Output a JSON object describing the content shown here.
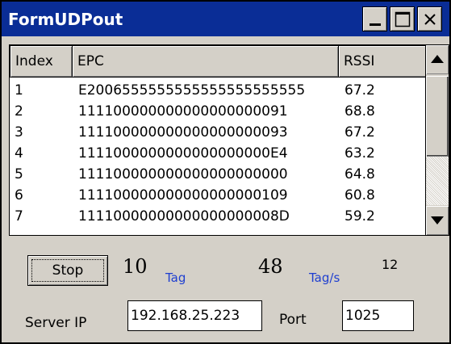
{
  "window": {
    "title": "FormUDPout"
  },
  "table": {
    "headers": [
      "Index",
      "EPC",
      "RSSI"
    ],
    "rows": [
      [
        "1",
        "E2006555555555555555555555",
        "67.2"
      ],
      [
        "2",
        "111100000000000000000091",
        "68.8"
      ],
      [
        "3",
        "111100000000000000000093",
        "67.2"
      ],
      [
        "4",
        "1111000000000000000000E4",
        "63.2"
      ],
      [
        "5",
        "111100000000000000000000",
        "64.8"
      ],
      [
        "6",
        "111100000000000000000109",
        "60.8"
      ],
      [
        "7",
        "11110000000000000000008D",
        "59.2"
      ]
    ]
  },
  "controls": {
    "stop_label": "Stop",
    "tag_count": "10",
    "tag_unit": "Tag",
    "rate": "48",
    "rate_unit": "Tag/s",
    "extra": "12",
    "server_ip_label": "Server IP",
    "server_ip_value": "192.168.25.223",
    "port_label": "Port",
    "port_value": "1025"
  },
  "icons": {
    "minimize": "minimize-icon",
    "maximize": "maximize-icon",
    "close": "close-icon",
    "scroll_up": "arrow-up-icon",
    "scroll_down": "arrow-down-icon"
  },
  "colors": {
    "titlebar": "#0a2d96",
    "unit_text": "#1f3fd0",
    "face": "#d4d0c8"
  }
}
